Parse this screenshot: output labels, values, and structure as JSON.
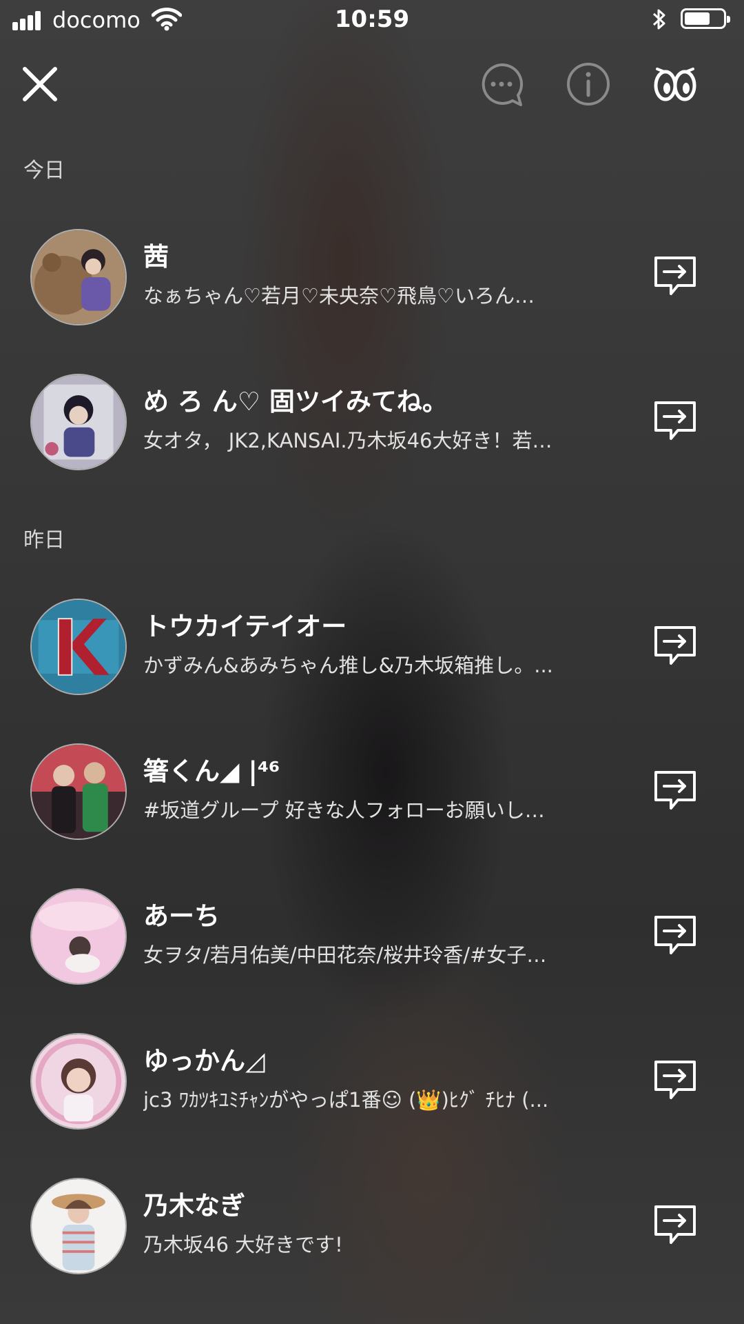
{
  "status_bar": {
    "carrier": "docomo",
    "time": "10:59",
    "signal_icon": "signal-bars-icon",
    "wifi_icon": "wifi-icon",
    "bluetooth_icon": "bluetooth-icon",
    "battery_icon": "battery-icon",
    "battery_level": 0.6
  },
  "nav": {
    "close_icon": "close-icon",
    "comment_icon": "chat-bubble-icon",
    "info_icon": "info-icon",
    "viewers_icon": "eyes-icon"
  },
  "sections": [
    {
      "label": "今日",
      "users": [
        {
          "name": "茜",
          "bio": "なぁちゃん♡若月♡未央奈♡飛鳥♡いろん…"
        },
        {
          "name": "め ろ ん♡ 固ツイみてね。",
          "bio": "女オタ， JK2,KANSAI.乃木坂46大好き！若…"
        }
      ]
    },
    {
      "label": "昨日",
      "users": [
        {
          "name": "トウカイテイオー",
          "bio": "かずみん&あみちゃん推し&乃木坂箱推し。..."
        },
        {
          "name": "箸くん◢ |⁴⁶",
          "bio": "#坂道グループ 好きな人フォローお願いし…"
        },
        {
          "name": "あーち",
          "bio": "女ヲタ/若月佑美/中田花奈/桜井玲香/#女子…"
        },
        {
          "name": "ゆっかん◿",
          "bio": "jc3 ﾜｶﾂｷﾕﾐﾁｬﾝがやっぱ1番☺ (👑)ﾋｸﾞ ﾁﾋﾅ (..."
        },
        {
          "name": "乃木なぎ",
          "bio": "乃木坂46 大好きです!"
        }
      ]
    }
  ],
  "share_icon": "share-arrow-icon",
  "colors": {
    "background": "#363636",
    "text_primary": "#ffffff",
    "text_secondary": "#e2e2e2",
    "nav_icon_muted": "#8a8a8a"
  }
}
